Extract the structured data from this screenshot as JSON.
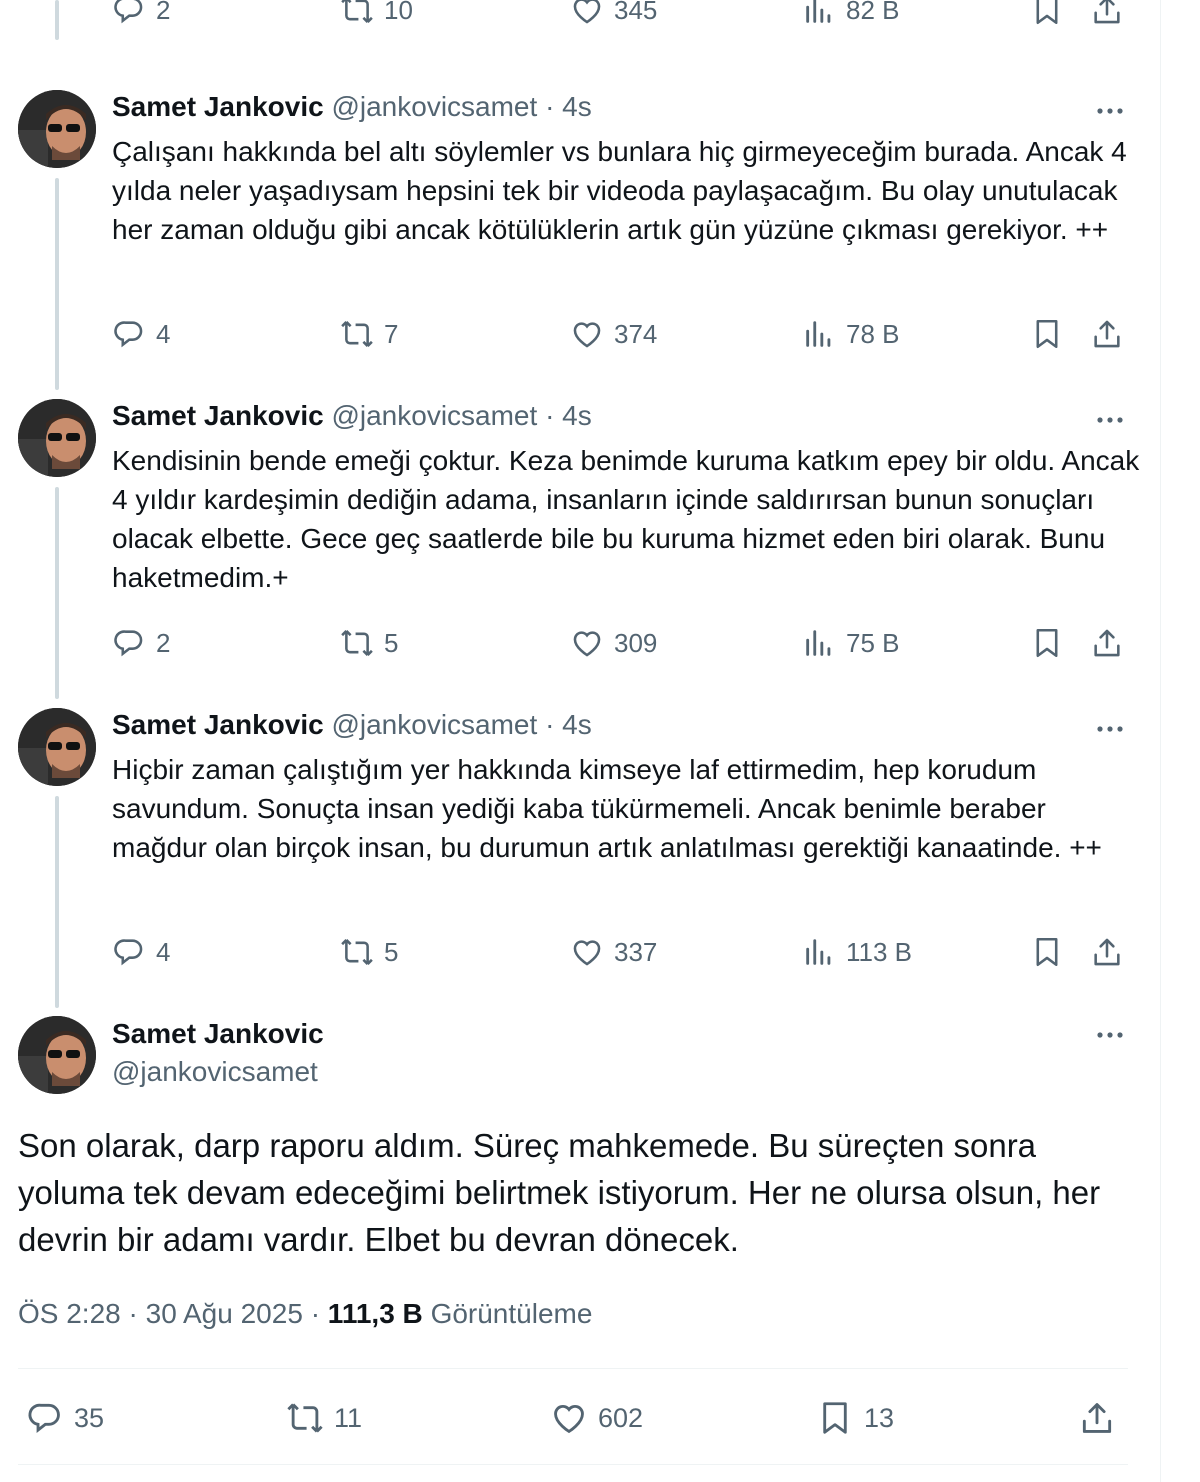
{
  "top_partial": {
    "replies": "2",
    "retweets": "10",
    "likes": "345",
    "views": "82 B"
  },
  "tweets": [
    {
      "name": "Samet Jankovic",
      "handle": "@jankovicsamet",
      "time": "· 4s",
      "text": "Çalışanı hakkında bel altı söylemler vs bunlara hiç girmeyeceğim burada. Ancak 4 yılda neler yaşadıysam hepsini tek bir videoda paylaşacağım. Bu olay unutulacak her zaman olduğu gibi ancak kötülüklerin artık gün yüzüne çıkması gerekiyor. ++",
      "replies": "4",
      "retweets": "7",
      "likes": "374",
      "views": "78 B"
    },
    {
      "name": "Samet Jankovic",
      "handle": "@jankovicsamet",
      "time": "· 4s",
      "text": "Kendisinin bende emeği çoktur. Keza benimde kuruma katkım epey bir oldu. Ancak 4 yıldır kardeşimin dediğin adama, insanların içinde saldırırsan bunun sonuçları olacak elbette. Gece geç saatlerde bile bu kuruma hizmet eden biri olarak. Bunu haketmedim.+",
      "replies": "2",
      "retweets": "5",
      "likes": "309",
      "views": "75 B"
    },
    {
      "name": "Samet Jankovic",
      "handle": "@jankovicsamet",
      "time": "· 4s",
      "text": "Hiçbir zaman çalıştığım yer hakkında kimseye laf ettirmedim, hep korudum savundum. Sonuçta insan yediği kaba tükürmemeli. Ancak benimle beraber mağdur olan birçok insan, bu durumun artık anlatılması gerektiği kanaatinde. ++",
      "replies": "4",
      "retweets": "5",
      "likes": "337",
      "views": "113 B"
    }
  ],
  "main": {
    "name": "Samet Jankovic",
    "handle": "@jankovicsamet",
    "text": "Son olarak, darp raporu aldım. Süreç mahkemede. Bu süreçten sonra yoluma tek devam edeceğimi belirtmek istiyorum. Her ne olursa olsun, her devrin bir adamı vardır. Elbet bu devran dönecek.",
    "time": "ÖS 2:28",
    "date": "30 Ağu 2025",
    "views_count": "111,3 B",
    "views_label": "Görüntüleme",
    "replies": "35",
    "retweets": "11",
    "likes": "602",
    "bookmarks": "13"
  },
  "icons": {
    "reply": "reply-icon",
    "retweet": "retweet-icon",
    "like": "heart-icon",
    "views": "views-icon",
    "bookmark": "bookmark-icon",
    "share": "share-icon",
    "more": "more-icon"
  },
  "colors": {
    "text": "#0f1419",
    "secondary": "#536471",
    "thread_line": "#cfd9de",
    "divider": "#eff3f4"
  }
}
